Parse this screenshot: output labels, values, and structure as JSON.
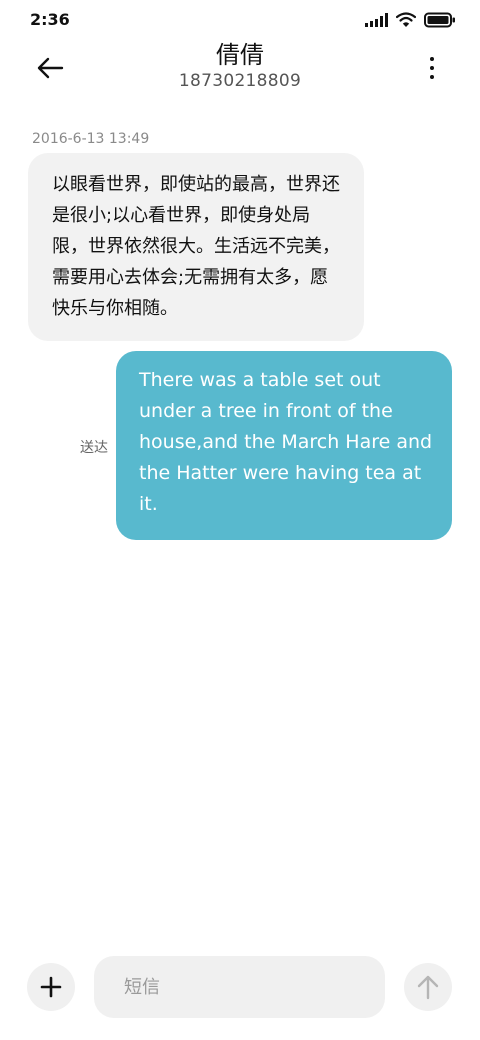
{
  "status_bar": {
    "time": "2:36",
    "icons": [
      "signal-icon",
      "wifi-icon",
      "battery-icon"
    ]
  },
  "header": {
    "contact_name": "倩倩",
    "phone_number": "18730218809",
    "back_icon": "back-arrow-icon",
    "menu_icon": "more-vertical-icon"
  },
  "conversation": {
    "timestamp": "2016-6-13 13:49",
    "incoming_message": "以眼看世界，即使站的最高，世界还是很小;以心看世界，即使身处局限，世界依然很大。生活远不完美，需要用心去体会;无需拥有太多，愿快乐与你相随。",
    "outgoing_message": "There was a table set out under a tree in front of the house,and the March Hare and the Hatter were having tea at it.",
    "outgoing_status": "送达"
  },
  "composer": {
    "placeholder": "短信",
    "value": "",
    "add_icon": "plus-icon",
    "send_icon": "up-arrow-icon"
  },
  "colors": {
    "outgoing_bubble": "#58b9ce",
    "incoming_bubble": "#f2f2f2",
    "input_background": "#f0f0f0"
  }
}
